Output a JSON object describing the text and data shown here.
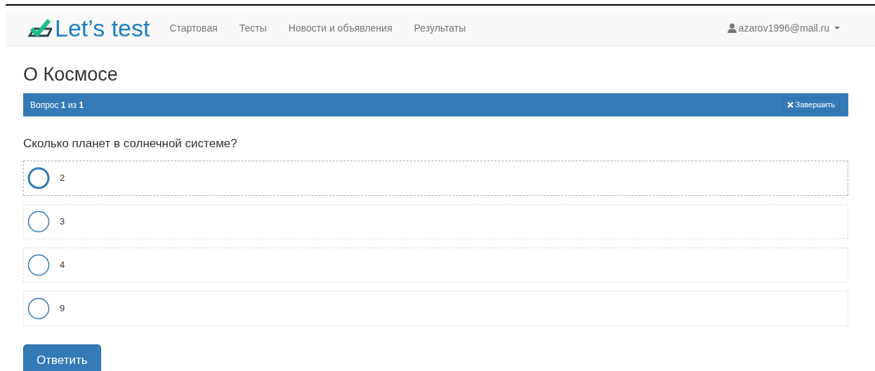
{
  "navbar": {
    "brand": "Let’s test",
    "links": [
      "Стартовая",
      "Тесты",
      "Новости и объявления",
      "Результаты"
    ],
    "user": "azarov1996@mail.ru"
  },
  "test": {
    "title": "О Космосе",
    "progress": "Вопрос **1** из **1**",
    "finish_button": "Завершить",
    "question": "Сколько планет в солнечной системе?",
    "options": [
      {
        "label": "2",
        "focused": true,
        "selected": false
      },
      {
        "label": "3",
        "focused": false,
        "selected": false
      },
      {
        "label": "4",
        "focused": false,
        "selected": false
      },
      {
        "label": "9",
        "focused": false,
        "selected": false
      }
    ],
    "submit_button": "Ответить"
  }
}
